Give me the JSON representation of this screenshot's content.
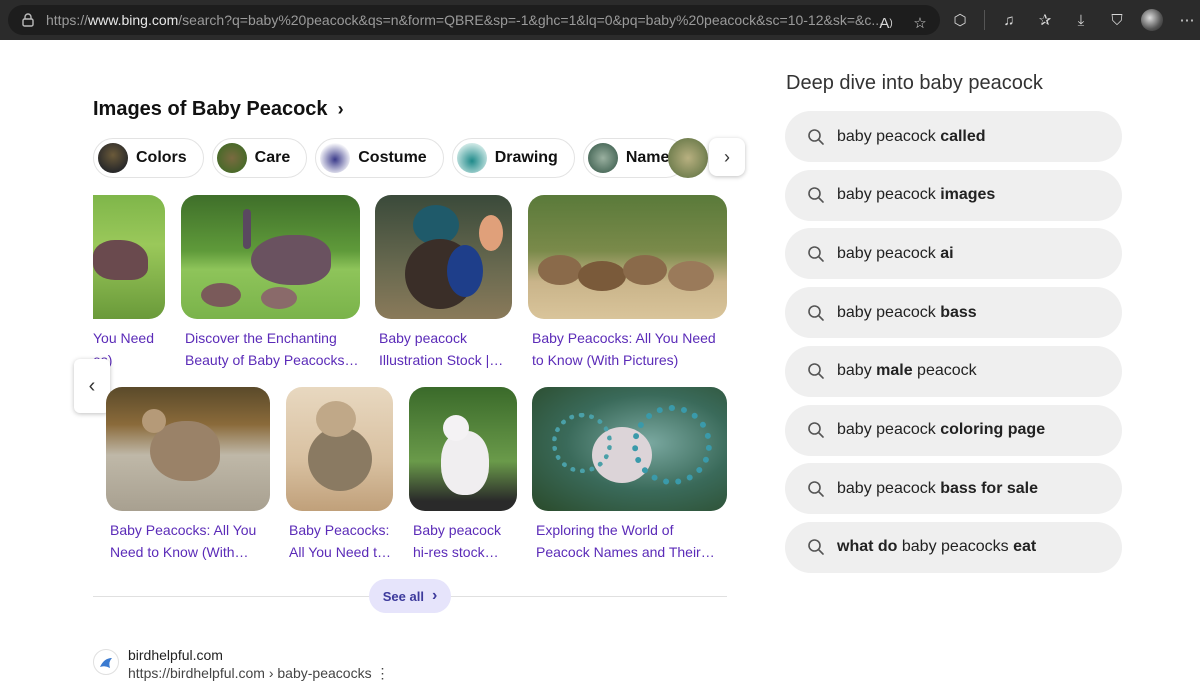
{
  "browser": {
    "url_prefix": "https://",
    "url_host": "www.bing.com",
    "url_rest": "/search?q=baby%20peacock&qs=n&form=QBRE&sp=-1&ghc=1&lq=0&pq=baby%20peacock&sc=10-12&sk=&c..."
  },
  "images_section": {
    "title": "Images of Baby Peacock",
    "chips": [
      {
        "label": "Colors"
      },
      {
        "label": "Care"
      },
      {
        "label": "Costume"
      },
      {
        "label": "Drawing"
      },
      {
        "label": "Name"
      }
    ],
    "row1": [
      {
        "line1": "You Need",
        "line2": "es)"
      },
      {
        "line1": "Discover the Enchanting",
        "line2": "Beauty of Baby Peacocks…"
      },
      {
        "line1": "Baby peacock",
        "line2": "Illustration Stock |…"
      },
      {
        "line1": "Baby Peacocks: All You Need",
        "line2": "to Know (With Pictures)"
      }
    ],
    "row2": [
      {
        "line1": "Baby Peacocks: All You",
        "line2": "Need to Know (With…"
      },
      {
        "line1": "Baby Peacocks:",
        "line2": "All You Need t…"
      },
      {
        "line1": "Baby peacock",
        "line2": "hi-res stock…"
      },
      {
        "line1": "Exploring the World of",
        "line2": "Peacock Names and Their…"
      }
    ],
    "see_all": "See all"
  },
  "result": {
    "site_name": "birdhelpful.com",
    "site_url": "https://birdhelpful.com › baby-peacocks"
  },
  "deep_dive": {
    "title": "Deep dive into baby peacock",
    "suggestions": [
      {
        "normal": "baby peacock ",
        "bold": "called",
        "tail": ""
      },
      {
        "normal": "baby peacock ",
        "bold": "images",
        "tail": ""
      },
      {
        "normal": "baby peacock ",
        "bold": "ai",
        "tail": ""
      },
      {
        "normal": "baby peacock ",
        "bold": "bass",
        "tail": ""
      },
      {
        "normal": "baby ",
        "bold": "male",
        "tail": " peacock"
      },
      {
        "normal": "baby peacock ",
        "bold": "coloring page",
        "tail": ""
      },
      {
        "normal": "baby peacock ",
        "bold": "bass for sale",
        "tail": ""
      },
      {
        "prefix_bold": "what do",
        "normal": " baby peacocks ",
        "bold": "eat",
        "tail": ""
      }
    ]
  },
  "colors": {
    "link": "#5b2bb8",
    "chip_bg": "#ffffff",
    "suggestion_bg": "#efefef",
    "see_all_bg": "#e6e4fb"
  }
}
